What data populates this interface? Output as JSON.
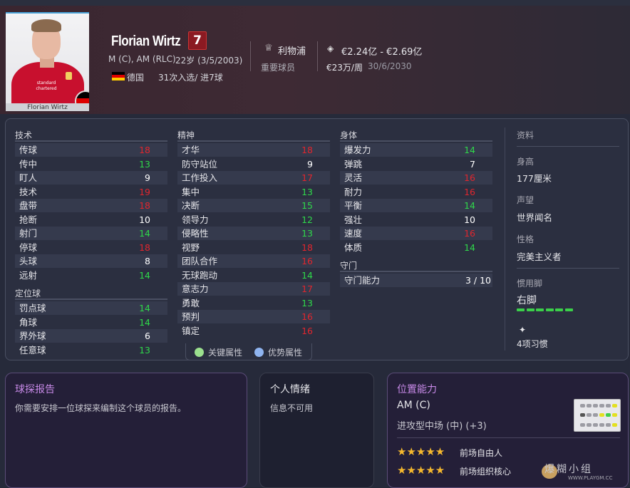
{
  "player": {
    "name": "Florian Wirtz",
    "number": "7",
    "positions": "M (C), AM (RLC)",
    "age": "22岁 (3/5/2003)",
    "nation": "德国",
    "caps": "31次入选/ 进7球",
    "photo_caption": "Florian Wirtz",
    "club": "利物浦",
    "role": "重要球员",
    "value": "€2.24亿 - €2.69亿",
    "wage": "€23万/周",
    "contract": "30/6/2030"
  },
  "colors": {
    "red": "#e0262e",
    "green": "#2fd84a",
    "white": "#ffffff"
  },
  "attributes": {
    "technical_title": "技术",
    "technical": [
      {
        "name": "传球",
        "value": "18",
        "color": "red"
      },
      {
        "name": "传中",
        "value": "13",
        "color": "green"
      },
      {
        "name": "盯人",
        "value": "9",
        "color": "white"
      },
      {
        "name": "技术",
        "value": "19",
        "color": "red"
      },
      {
        "name": "盘带",
        "value": "18",
        "color": "red"
      },
      {
        "name": "抢断",
        "value": "10",
        "color": "white"
      },
      {
        "name": "射门",
        "value": "14",
        "color": "green"
      },
      {
        "name": "停球",
        "value": "18",
        "color": "red"
      },
      {
        "name": "头球",
        "value": "8",
        "color": "white"
      },
      {
        "name": "远射",
        "value": "14",
        "color": "green"
      }
    ],
    "setpieces_title": "定位球",
    "setpieces": [
      {
        "name": "罚点球",
        "value": "14",
        "color": "green"
      },
      {
        "name": "角球",
        "value": "14",
        "color": "green"
      },
      {
        "name": "界外球",
        "value": "6",
        "color": "white"
      },
      {
        "name": "任意球",
        "value": "13",
        "color": "green"
      }
    ],
    "mental_title": "精神",
    "mental": [
      {
        "name": "才华",
        "value": "18",
        "color": "red"
      },
      {
        "name": "防守站位",
        "value": "9",
        "color": "white"
      },
      {
        "name": "工作投入",
        "value": "17",
        "color": "red"
      },
      {
        "name": "集中",
        "value": "13",
        "color": "green"
      },
      {
        "name": "决断",
        "value": "15",
        "color": "green"
      },
      {
        "name": "领导力",
        "value": "12",
        "color": "green"
      },
      {
        "name": "侵略性",
        "value": "13",
        "color": "green"
      },
      {
        "name": "视野",
        "value": "18",
        "color": "red"
      },
      {
        "name": "团队合作",
        "value": "16",
        "color": "red"
      },
      {
        "name": "无球跑动",
        "value": "14",
        "color": "green"
      },
      {
        "name": "意志力",
        "value": "17",
        "color": "red"
      },
      {
        "name": "勇敢",
        "value": "13",
        "color": "green"
      },
      {
        "name": "预判",
        "value": "16",
        "color": "red"
      },
      {
        "name": "镇定",
        "value": "16",
        "color": "red"
      }
    ],
    "physical_title": "身体",
    "physical": [
      {
        "name": "爆发力",
        "value": "14",
        "color": "green"
      },
      {
        "name": "弹跳",
        "value": "7",
        "color": "white"
      },
      {
        "name": "灵活",
        "value": "16",
        "color": "red"
      },
      {
        "name": "耐力",
        "value": "16",
        "color": "red"
      },
      {
        "name": "平衡",
        "value": "14",
        "color": "green"
      },
      {
        "name": "强壮",
        "value": "10",
        "color": "white"
      },
      {
        "name": "速度",
        "value": "16",
        "color": "red"
      },
      {
        "name": "体质",
        "value": "14",
        "color": "green"
      }
    ],
    "gk_title": "守门",
    "gk": [
      {
        "name": "守门能力",
        "value": "3 / 10",
        "color": "white"
      }
    ]
  },
  "info": {
    "title": "资料",
    "height_label": "身高",
    "height": "177厘米",
    "reputation_label": "声望",
    "reputation": "世界闻名",
    "personality_label": "性格",
    "personality": "完美主义者",
    "foot_label": "惯用脚",
    "foot": "右脚",
    "foot_level": 6,
    "habits": "4项习惯"
  },
  "legend": {
    "key": "关键属性",
    "key_color": "#9be08e",
    "strong": "优势属性",
    "strong_color": "#8fb4f0"
  },
  "scout": {
    "title": "球探报告",
    "text": "你需要安排一位球探来编制这个球员的报告。"
  },
  "mood": {
    "title": "个人情绪",
    "text": "信息不可用"
  },
  "position_ability": {
    "title": "位置能力",
    "position": "AM (C)",
    "role": "进攻型中场 (中) (+3)",
    "traits": [
      {
        "stars": "★★★★★",
        "label": "前场自由人"
      },
      {
        "stars": "★★★★★",
        "label": "前场组织核心"
      }
    ]
  },
  "watermark": {
    "text": "爆糊小组",
    "url": "WWW.PLAYGM.CC"
  }
}
